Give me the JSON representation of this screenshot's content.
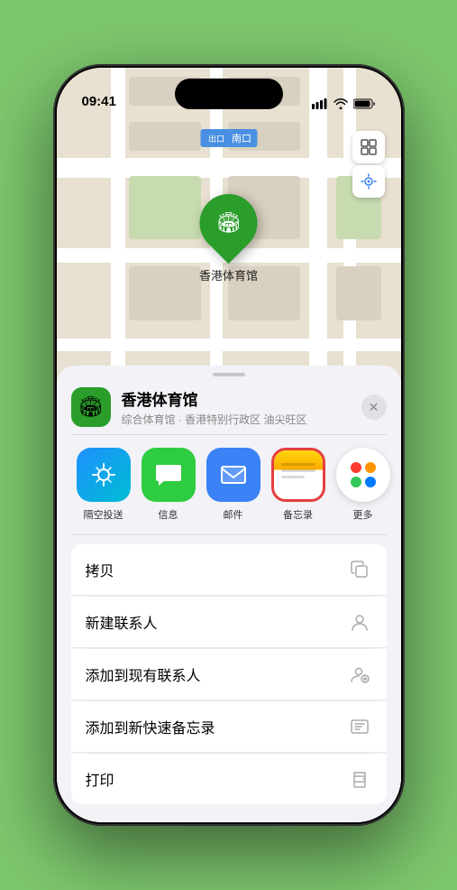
{
  "device": {
    "time": "09:41",
    "location_arrow": true
  },
  "map": {
    "venue_label": "南口",
    "pin_label": "香港体育馆",
    "pin_emoji": "🏟"
  },
  "sheet": {
    "close_label": "✕",
    "venue_name": "香港体育馆",
    "venue_subtitle": "综合体育馆 · 香港特别行政区 油尖旺区",
    "venue_emoji": "🏟"
  },
  "share_items": [
    {
      "id": "airdrop",
      "label": "隔空投送",
      "type": "airdrop"
    },
    {
      "id": "messages",
      "label": "信息",
      "type": "messages"
    },
    {
      "id": "mail",
      "label": "邮件",
      "type": "mail"
    },
    {
      "id": "notes",
      "label": "备忘录",
      "type": "notes"
    },
    {
      "id": "more",
      "label": "更多",
      "type": "more"
    }
  ],
  "action_rows": [
    {
      "id": "copy",
      "label": "拷贝",
      "icon": "📋"
    },
    {
      "id": "new-contact",
      "label": "新建联系人",
      "icon": "👤"
    },
    {
      "id": "add-contact",
      "label": "添加到现有联系人",
      "icon": "➕"
    },
    {
      "id": "quick-note",
      "label": "添加到新快速备忘录",
      "icon": "📝"
    },
    {
      "id": "print",
      "label": "打印",
      "icon": "🖨"
    }
  ],
  "colors": {
    "accent_green": "#2a9d2a",
    "notes_selected_border": "#e53e3e",
    "background": "#7dc86e"
  }
}
